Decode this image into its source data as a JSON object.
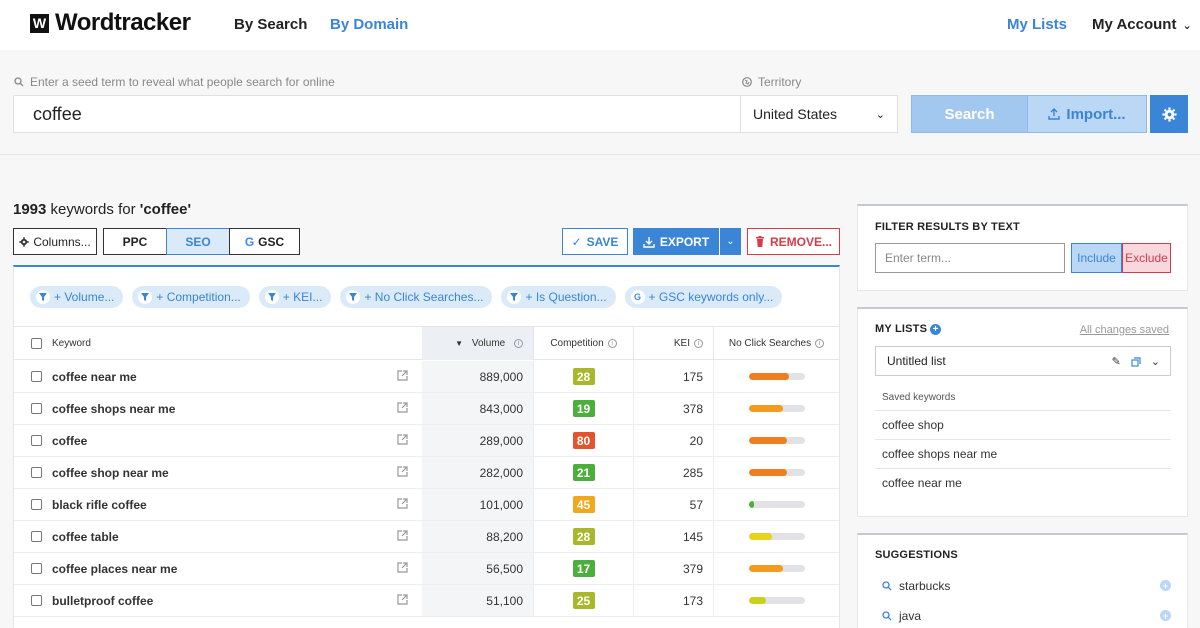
{
  "brand": {
    "logo_mark": "W",
    "name": "Wordtracker"
  },
  "nav": {
    "by_search": "By Search",
    "by_domain": "By Domain",
    "my_lists": "My Lists",
    "my_account": "My Account"
  },
  "search": {
    "hint": "Enter a seed term to reveal what people search for online",
    "value": "coffee",
    "territory_label": "Territory",
    "territory_value": "United States",
    "search_button": "Search",
    "import_button": "Import..."
  },
  "results": {
    "count": "1993",
    "count_text": " keywords for ",
    "term": "'coffee'",
    "columns_button": "Columns...",
    "seg_ppc": "PPC",
    "seg_seo": "SEO",
    "seg_gsc": "GSC",
    "save": "SAVE",
    "export": "EXPORT",
    "remove": "REMOVE..."
  },
  "chips": [
    "+ Volume...",
    "+ Competition...",
    "+ KEI...",
    "+ No Click Searches...",
    "+ Is Question...",
    "+ GSC keywords only..."
  ],
  "table": {
    "headers": {
      "keyword": "Keyword",
      "volume": "Volume",
      "competition": "Competition",
      "kei": "KEI",
      "ncs": "No Click Searches"
    },
    "rows": [
      {
        "keyword": "coffee near me",
        "volume": "889,000",
        "competition": "28",
        "comp_color": "#a8b82a",
        "kei": "175",
        "ncs": 0.72,
        "ncs_color": "#f07d1f"
      },
      {
        "keyword": "coffee shops near me",
        "volume": "843,000",
        "competition": "19",
        "comp_color": "#4caf3c",
        "kei": "378",
        "ncs": 0.62,
        "ncs_color": "#f49a1f"
      },
      {
        "keyword": "coffee",
        "volume": "289,000",
        "competition": "80",
        "comp_color": "#e2542e",
        "kei": "20",
        "ncs": 0.68,
        "ncs_color": "#f07d1f"
      },
      {
        "keyword": "coffee shop near me",
        "volume": "282,000",
        "competition": "21",
        "comp_color": "#4caf3c",
        "kei": "285",
        "ncs": 0.68,
        "ncs_color": "#f07d1f"
      },
      {
        "keyword": "black rifle coffee",
        "volume": "101,000",
        "competition": "45",
        "comp_color": "#f0a81e",
        "kei": "57",
        "ncs": 0.1,
        "ncs_color": "#4caf3c"
      },
      {
        "keyword": "coffee table",
        "volume": "88,200",
        "competition": "28",
        "comp_color": "#a8b82a",
        "kei": "145",
        "ncs": 0.42,
        "ncs_color": "#e8d21a"
      },
      {
        "keyword": "coffee places near me",
        "volume": "56,500",
        "competition": "17",
        "comp_color": "#4caf3c",
        "kei": "379",
        "ncs": 0.62,
        "ncs_color": "#f49a1f"
      },
      {
        "keyword": "bulletproof coffee",
        "volume": "51,100",
        "competition": "25",
        "comp_color": "#a8b82a",
        "kei": "173",
        "ncs": 0.32,
        "ncs_color": "#c8d21a"
      }
    ]
  },
  "filter": {
    "title": "FILTER RESULTS BY TEXT",
    "placeholder": "Enter term...",
    "include": "Include",
    "exclude": "Exclude"
  },
  "lists": {
    "title": "MY LISTS",
    "status": "All changes saved",
    "selected": "Untitled list",
    "saved_label": "Saved keywords",
    "saved": [
      "coffee shop",
      "coffee shops near me",
      "coffee near me"
    ]
  },
  "suggestions": {
    "title": "SUGGESTIONS",
    "items": [
      "starbucks",
      "java"
    ]
  }
}
